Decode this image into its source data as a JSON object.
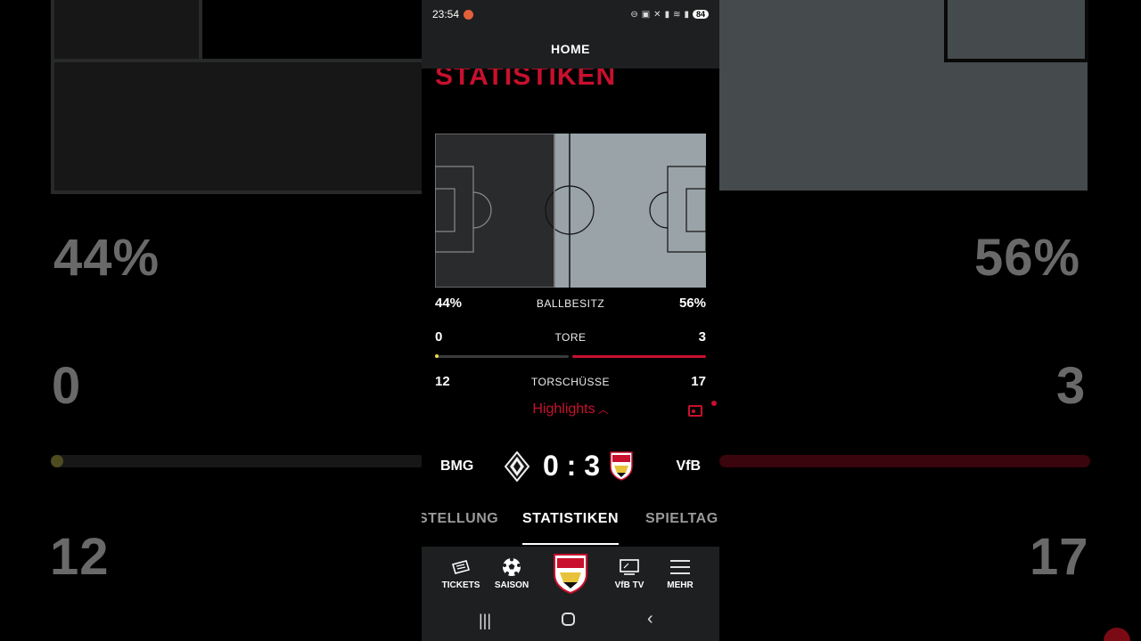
{
  "status_bar": {
    "time": "23:54",
    "battery": "84"
  },
  "header": {
    "title": "HOME"
  },
  "section": {
    "title": "STATISTIKEN"
  },
  "possession": {
    "home": "44%",
    "label": "BALLBESITZ",
    "away": "56%",
    "home_fraction": 0.44
  },
  "goals": {
    "home": "0",
    "label": "TORE",
    "away": "3"
  },
  "shots": {
    "home": "12",
    "label": "TORSCHÜSSE",
    "away": "17"
  },
  "highlights": {
    "label": "Highlights"
  },
  "match": {
    "home_team": "BMG",
    "away_team": "VfB",
    "score": "0 : 3"
  },
  "tabs": [
    {
      "label": "STELLUNG"
    },
    {
      "label": "STATISTIKEN"
    },
    {
      "label": "SPIELTAG"
    }
  ],
  "bottom_nav": [
    {
      "label": "TICKETS",
      "icon": "ticket-icon"
    },
    {
      "label": "SAISON",
      "icon": "football-icon"
    },
    {
      "label": "",
      "icon": "vfb-crest-icon"
    },
    {
      "label": "VfB TV",
      "icon": "tv-icon"
    },
    {
      "label": "MEHR",
      "icon": "menu-icon"
    }
  ],
  "colors": {
    "accent": "#c8102e",
    "panel": "#1e1f20",
    "pitch_dark": "#2a2b2c",
    "pitch_light": "#9aa3a8"
  }
}
